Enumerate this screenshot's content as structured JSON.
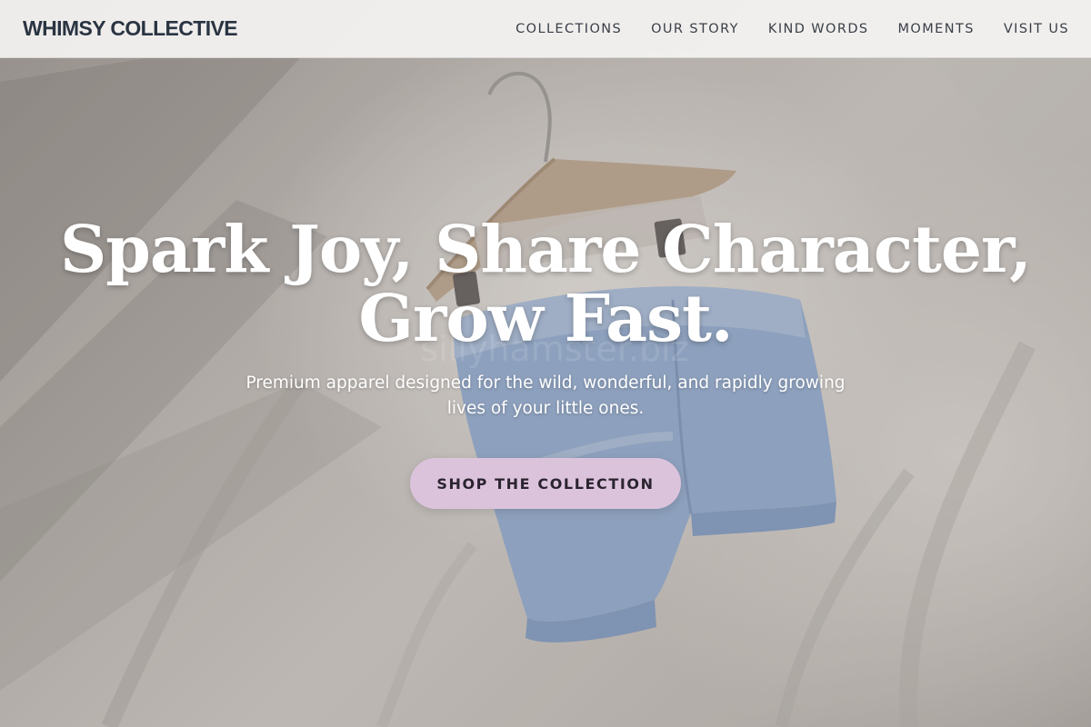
{
  "nav": {
    "brand": "WHIMSY COLLECTIVE",
    "items": [
      {
        "label": "COLLECTIONS"
      },
      {
        "label": "OUR STORY"
      },
      {
        "label": "KIND WORDS"
      },
      {
        "label": "MOMENTS"
      },
      {
        "label": "VISIT US"
      }
    ]
  },
  "hero": {
    "headline": "Spark Joy, Share Character, Grow Fast.",
    "subtitle": "Premium apparel designed for the wild, wonderful, and rapidly growing lives of your little ones.",
    "cta_label": "SHOP THE COLLECTION",
    "watermark": "sillyhamster.biz",
    "image_subject": "baby-bloomers-on-wooden-hanger"
  },
  "colors": {
    "brand_text": "#2a3442",
    "cta_background": "#dcc3dc",
    "cta_text": "#2b2430",
    "headline": "#ffffff"
  }
}
